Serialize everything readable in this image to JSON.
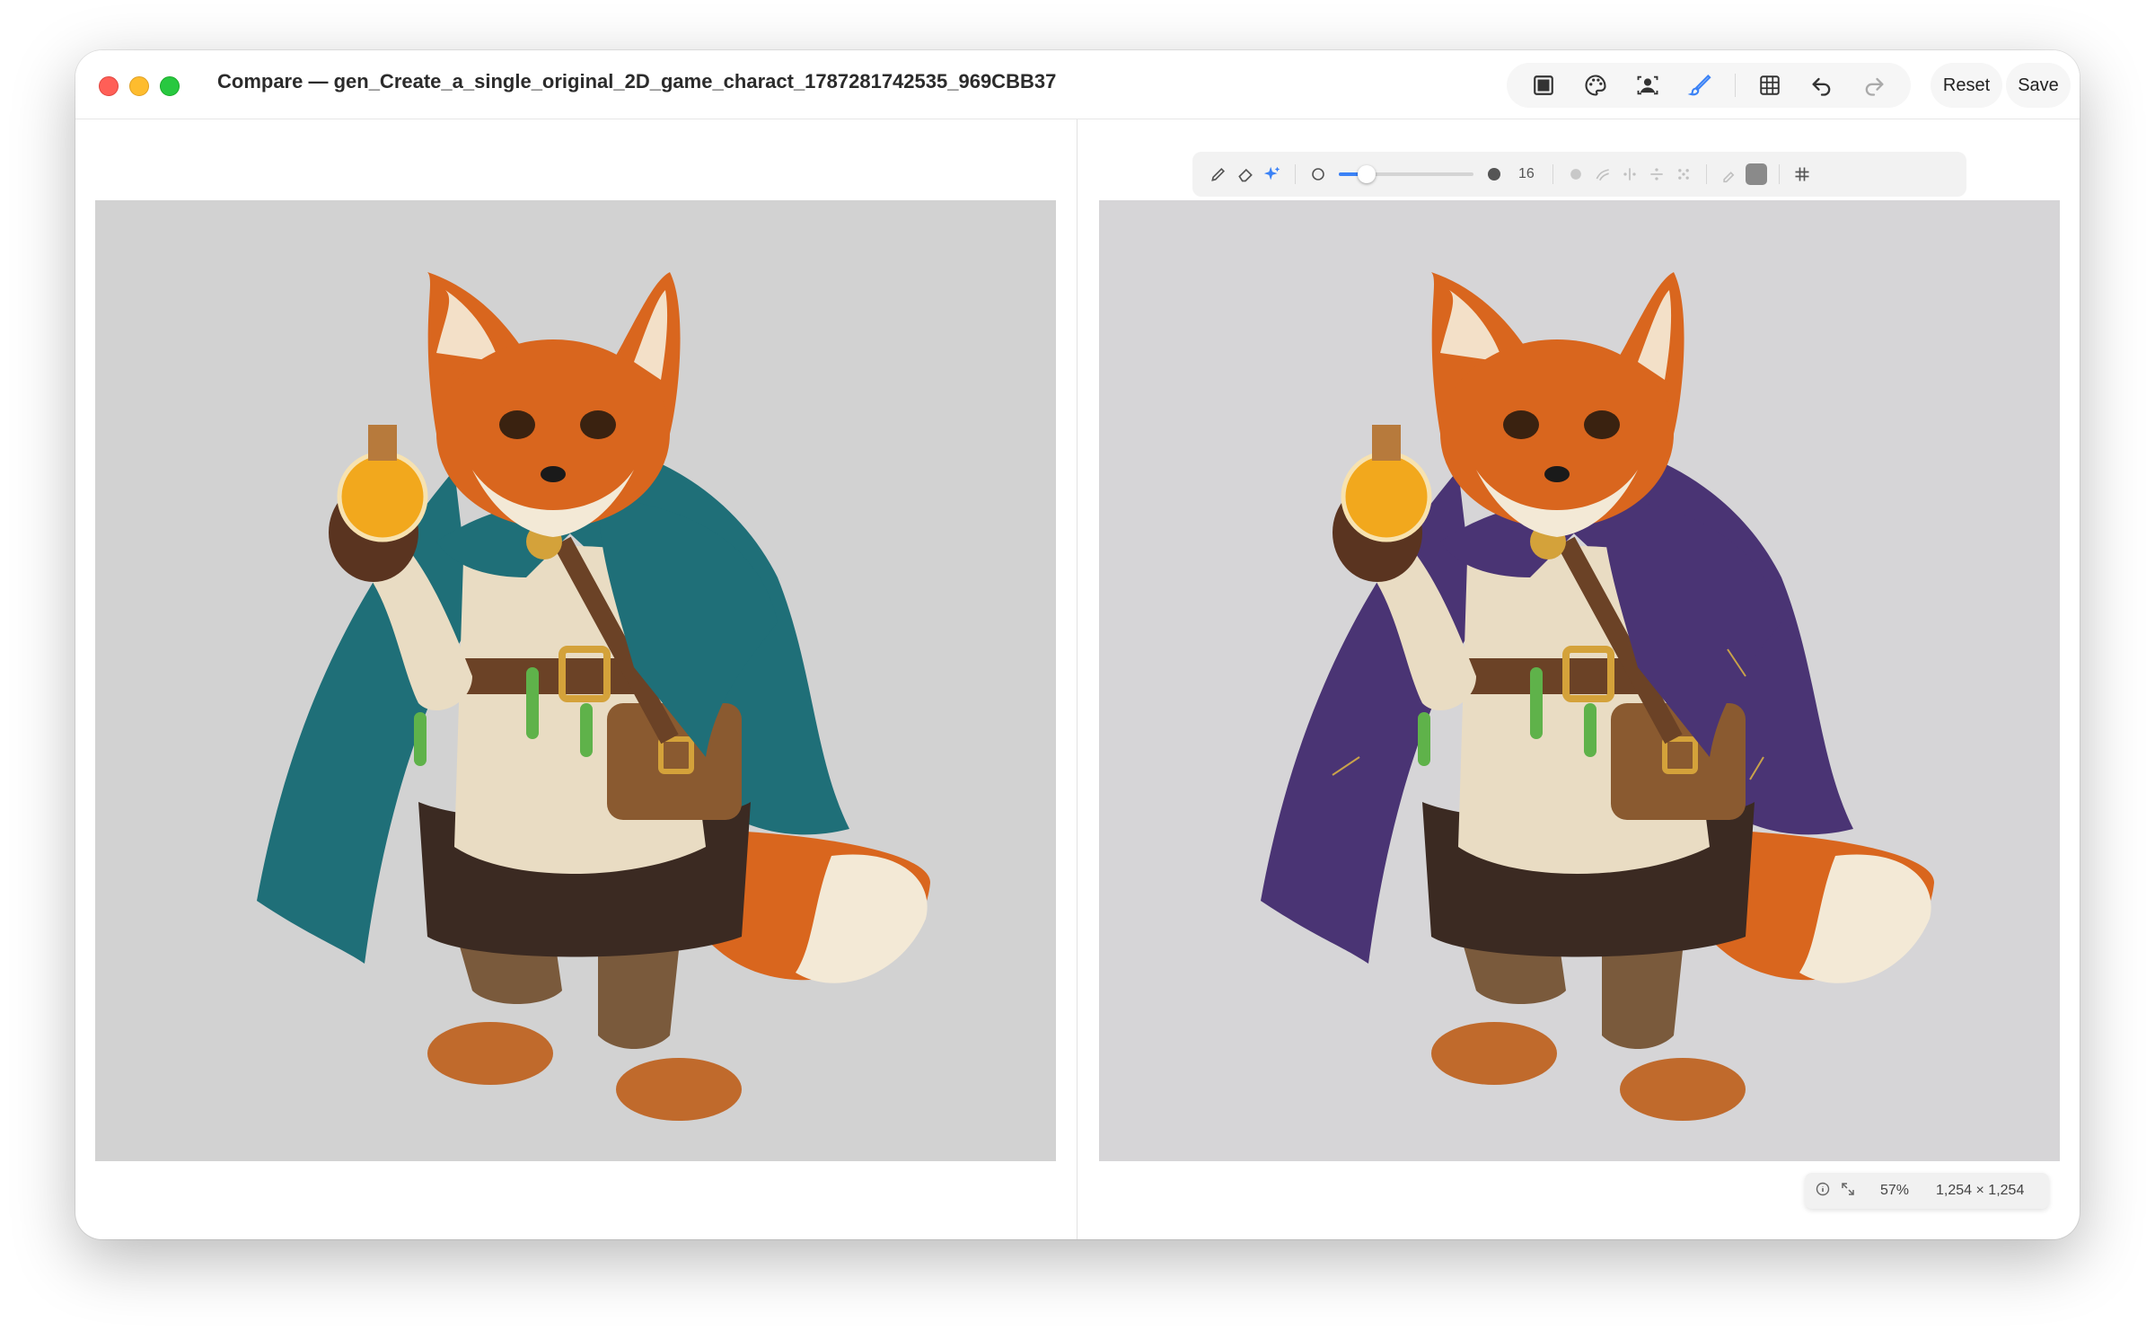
{
  "window": {
    "title": "Compare — gen_Create_a_single_original_2D_game_charact_1787281742535_969CBB37"
  },
  "toolbar": {
    "icons": [
      "single-view-icon",
      "palette-icon",
      "portrait-icon",
      "brush-icon",
      "grid-icon",
      "undo-icon",
      "redo-icon"
    ],
    "reset_label": "Reset",
    "save_label": "Save"
  },
  "tools": {
    "brush_size_value": "16",
    "brush_size_fraction": 0.16,
    "swatch_color": "#8a8a8a",
    "active_color": "#3b82f6"
  },
  "status": {
    "zoom": "57%",
    "dimensions": "1,254 × 1,254"
  },
  "images": {
    "left_cloak_color": "#1f6f78",
    "right_cloak_color": "#4a3474",
    "background_left": "#d2d2d2",
    "background_right": "#d6d5d7"
  }
}
